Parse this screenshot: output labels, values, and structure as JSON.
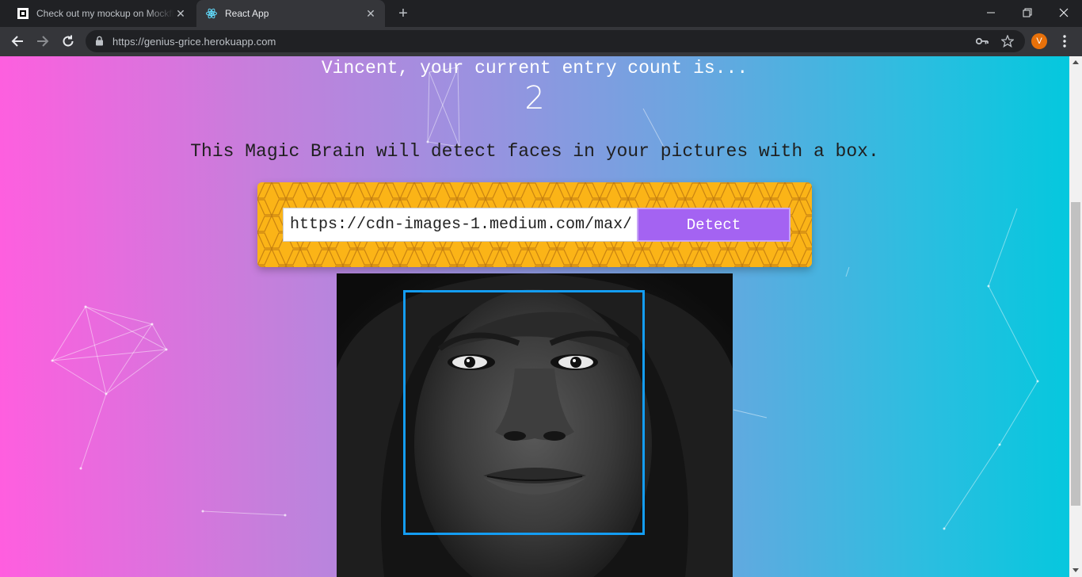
{
  "browser": {
    "tabs": [
      {
        "title": "Check out my mockup on Mockflow",
        "favicon": "mockflow-icon",
        "active": false
      },
      {
        "title": "React App",
        "favicon": "react-icon",
        "active": true
      }
    ],
    "url": "https://genius-grice.herokuapp.com",
    "profile_initial": "V"
  },
  "page": {
    "greeting": "Vincent, your current entry count is...",
    "entry_count": "2",
    "description": "This Magic Brain will detect faces in your pictures with a box.",
    "image_url_value": "https://cdn-images-1.medium.com/max/",
    "detect_label": "Detect"
  },
  "colors": {
    "gradient_left": "#ff5edf",
    "gradient_right": "#04c8de",
    "form_background": "#fbb417",
    "button": "#a463f2",
    "face_box": "#149df2"
  }
}
